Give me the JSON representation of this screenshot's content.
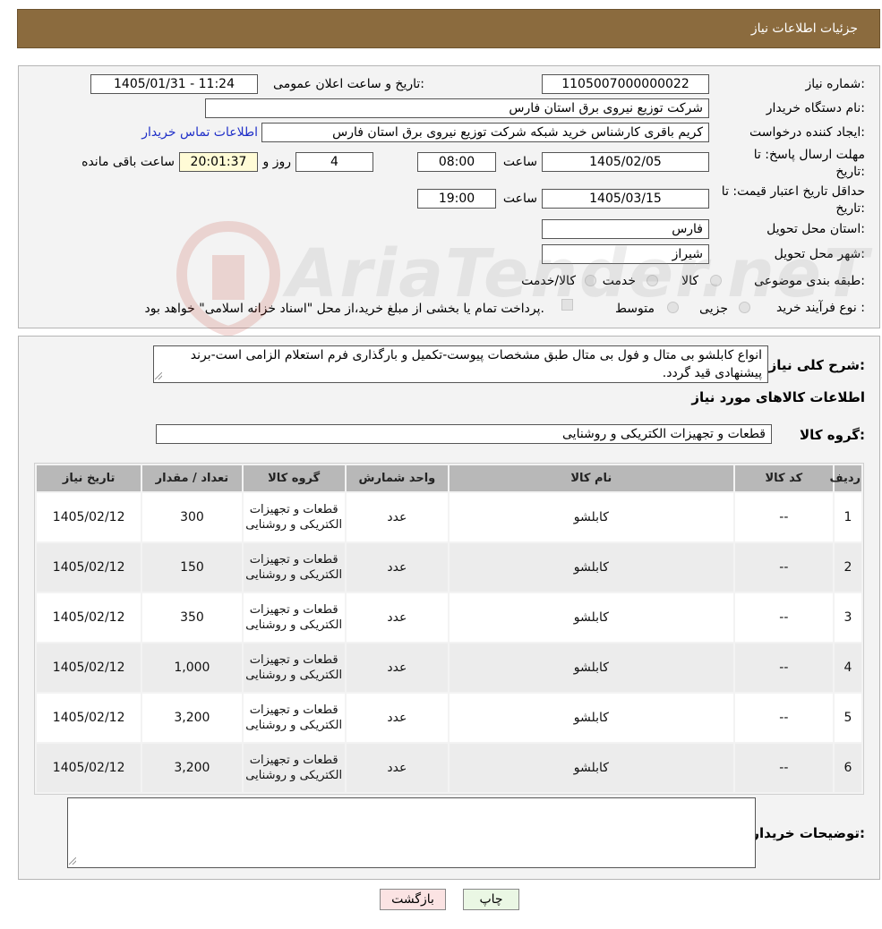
{
  "header": {
    "title": "جزئیات اطلاعات نیاز"
  },
  "details": {
    "need_number_label": "شماره نیاز:",
    "need_number": "1105007000000022",
    "announce_label": "تاریخ و ساعت اعلان عمومی:",
    "announce_value": "1405/01/31 - 11:24",
    "buyer_org_label": "نام دستگاه خریدار:",
    "buyer_org": "شرکت توزیع نیروی برق استان فارس",
    "creator_label": "ایجاد کننده درخواست:",
    "creator": "کریم باقری کارشناس خرید شبکه شرکت توزیع نیروی برق استان فارس",
    "contact_link": "اطلاعات تماس خریدار",
    "deadline_label": "مهلت ارسال پاسخ: تا تاریخ:",
    "deadline_date": "1405/02/05",
    "time_label": "ساعت",
    "deadline_time": "08:00",
    "days_value": "4",
    "days_label": "روز و",
    "countdown": "20:01:37",
    "remaining_label": "ساعت باقی مانده",
    "price_validity_label": "حداقل تاریخ اعتبار قیمت: تا تاریخ:",
    "price_validity_date": "1405/03/15",
    "price_validity_time": "19:00",
    "province_label": "استان محل تحویل:",
    "province": "فارس",
    "city_label": "شهر محل تحویل:",
    "city": "شیراز",
    "category_label": "طبقه بندی موضوعی:",
    "category_options": [
      "کالا",
      "خدمت",
      "کالا/خدمت"
    ],
    "process_label": "نوع فرآیند خرید :",
    "process_options": [
      "جزیی",
      "متوسط"
    ],
    "process_note": "پرداخت تمام یا بخشی از مبلغ خرید،از محل \"اسناد خزانه اسلامی\" خواهد بود."
  },
  "description": {
    "label": "شرح کلی نیاز:",
    "text": "انواع کابلشو بی متال و فول بی متال طبق مشخصات پیوست-تکمیل و بارگذاری فرم استعلام الزامی است-برند پیشنهادی قید گردد."
  },
  "goods": {
    "section_title": "اطلاعات کالاهای مورد نیاز",
    "group_label": "گروه کالا:",
    "group_value": "قطعات و تجهیزات الکتریکی و روشنایی",
    "columns": [
      "ردیف",
      "کد کالا",
      "نام کالا",
      "واحد شمارش",
      "گروه کالا",
      "تعداد / مقدار",
      "تاریخ نیاز"
    ],
    "rows": [
      {
        "idx": "1",
        "code": "--",
        "name": "کابلشو",
        "unit": "عدد",
        "group": "قطعات و تجهیزات الکتریکی و روشنایی",
        "qty": "300",
        "date": "1405/02/12"
      },
      {
        "idx": "2",
        "code": "--",
        "name": "کابلشو",
        "unit": "عدد",
        "group": "قطعات و تجهیزات الکتریکی و روشنایی",
        "qty": "150",
        "date": "1405/02/12"
      },
      {
        "idx": "3",
        "code": "--",
        "name": "کابلشو",
        "unit": "عدد",
        "group": "قطعات و تجهیزات الکتریکی و روشنایی",
        "qty": "350",
        "date": "1405/02/12"
      },
      {
        "idx": "4",
        "code": "--",
        "name": "کابلشو",
        "unit": "عدد",
        "group": "قطعات و تجهیزات الکتریکی و روشنایی",
        "qty": "1,000",
        "date": "1405/02/12"
      },
      {
        "idx": "5",
        "code": "--",
        "name": "کابلشو",
        "unit": "عدد",
        "group": "قطعات و تجهیزات الکتریکی و روشنایی",
        "qty": "3,200",
        "date": "1405/02/12"
      },
      {
        "idx": "6",
        "code": "--",
        "name": "کابلشو",
        "unit": "عدد",
        "group": "قطعات و تجهیزات الکتریکی و روشنایی",
        "qty": "3,200",
        "date": "1405/02/12"
      }
    ]
  },
  "buyer_notes": {
    "label": "توضیحات خریدار:",
    "value": ""
  },
  "buttons": {
    "print": "چاپ",
    "back": "بازگشت"
  },
  "watermark": {
    "text": "AriaTender.neT"
  },
  "colors": {
    "header_bg": "#8b6b3e",
    "link": "#1f2fc8",
    "print_bg": "#eaf7e4",
    "back_bg": "#fbe3e3",
    "countdown_bg": "#fffbd6"
  }
}
